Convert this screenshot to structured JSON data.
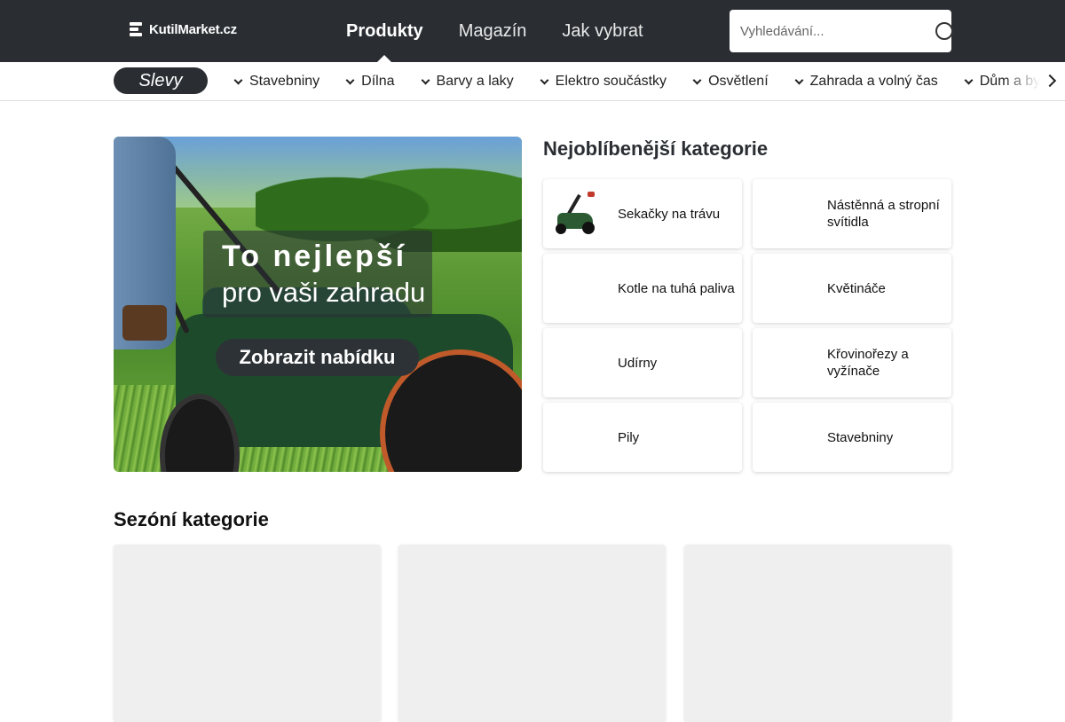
{
  "header": {
    "logo_text": "KutilMarket.cz",
    "nav": [
      {
        "label": "Produkty",
        "active": true
      },
      {
        "label": "Magazín",
        "active": false
      },
      {
        "label": "Jak vybrat",
        "active": false
      }
    ],
    "search": {
      "placeholder": "Vyhledávání..."
    }
  },
  "catbar": {
    "sale_label": "Slevy",
    "items": [
      "Stavebniny",
      "Dílna",
      "Barvy a laky",
      "Elektro součástky",
      "Osvětlení",
      "Zahrada a volný čas",
      "Dům a byt"
    ]
  },
  "hero": {
    "line1": "To nejlepší",
    "line2": "pro vaši zahradu",
    "button": "Zobrazit nabídku"
  },
  "popular": {
    "title": "Nejoblíbenější kategorie",
    "items": [
      {
        "label": "Sekačky na trávu",
        "icon": "lawn-mower-icon"
      },
      {
        "label": "Nástěnná a stropní svítidla",
        "icon": ""
      },
      {
        "label": "Kotle na tuhá paliva",
        "icon": ""
      },
      {
        "label": "Květináče",
        "icon": ""
      },
      {
        "label": "Udírny",
        "icon": ""
      },
      {
        "label": "Křovinořezy a vyžínače",
        "icon": ""
      },
      {
        "label": "Pily",
        "icon": ""
      },
      {
        "label": "Stavebniny",
        "icon": ""
      }
    ]
  },
  "seasonal": {
    "title": "Sezóní kategorie"
  },
  "colors": {
    "header_bg": "#2a2e33",
    "card_placeholder": "#efefef"
  }
}
